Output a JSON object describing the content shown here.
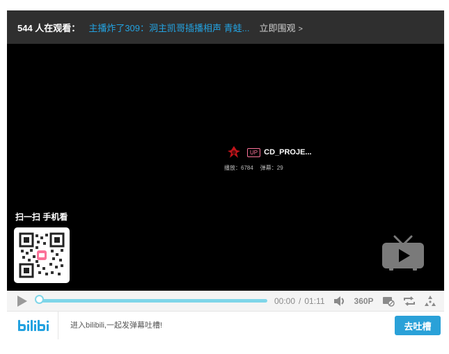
{
  "topbar": {
    "viewers": "544 人在观看：",
    "live_title": "主播炸了309：洞主凯哥插播相声 青蛙...",
    "watch_now": "立即围观",
    "watch_now_chevron": ">"
  },
  "video": {
    "up_badge": "UP",
    "up_name": "CD_PROJE...",
    "plays_label": "播放：6784",
    "danmaku_count_label": "弹幕：29"
  },
  "qr": {
    "label": "扫一扫 手机看"
  },
  "controls": {
    "current_time": "00:00",
    "separator": "/",
    "total_time": "01:11",
    "quality": "360P",
    "progress_fraction": 0.0
  },
  "bottom": {
    "danmaku_placeholder": "进入bilibili,一起发弹幕吐槽!",
    "send_label": "去吐槽"
  },
  "icons": [
    "play-icon",
    "volume-icon",
    "danmaku-toggle-icon",
    "loop-icon",
    "fullscreen-icon",
    "tv-icon",
    "bilibili-logo-icon",
    "up-avatar-icon"
  ],
  "colors": {
    "accent": "#23a2e0",
    "progress": "#7fd6e9",
    "send_button": "#2aa1d8",
    "up_badge": "#fb7299"
  }
}
